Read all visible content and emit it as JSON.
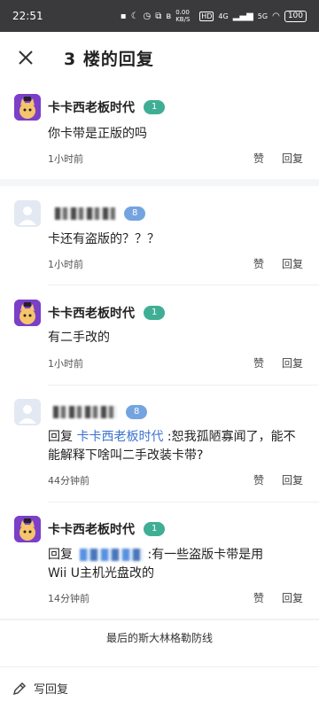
{
  "status_bar": {
    "time": "22:51",
    "net_speed": "0.00 KB/S",
    "hd": "HD",
    "signal1": "4G",
    "signal2": "5G",
    "battery": "100"
  },
  "header": {
    "title": "3 楼的回复"
  },
  "comments": [
    {
      "user": "卡卡西老板时代",
      "level": "1",
      "text": "你卡带是正版的吗",
      "time": "1小时前",
      "like": "赞",
      "reply": "回复"
    },
    {
      "user": "",
      "level": "8",
      "text": "卡还有盗版的？？？",
      "time": "1小时前",
      "like": "赞",
      "reply": "回复"
    },
    {
      "user": "卡卡西老板时代",
      "level": "1",
      "text": "有二手改的",
      "time": "1小时前",
      "like": "赞",
      "reply": "回复"
    },
    {
      "user": "",
      "level": "8",
      "reply_prefix": "回复",
      "reply_to": "卡卡西老板时代",
      "text": ":恕我孤陋寡闻了，能不能解释下啥叫二手改装卡带?",
      "time": "44分钟前",
      "like": "赞",
      "reply": "回复"
    },
    {
      "user": "卡卡西老板时代",
      "level": "1",
      "reply_prefix": "回复",
      "text_line1": ":有一些盗版卡带是用",
      "text_line2": "Wii U主机光盘改的",
      "time": "14分钟前",
      "like": "赞",
      "reply": "回复"
    }
  ],
  "end_note": "最后的斯大林格勒防线",
  "bottom_bar": {
    "write_reply": "写回复"
  }
}
